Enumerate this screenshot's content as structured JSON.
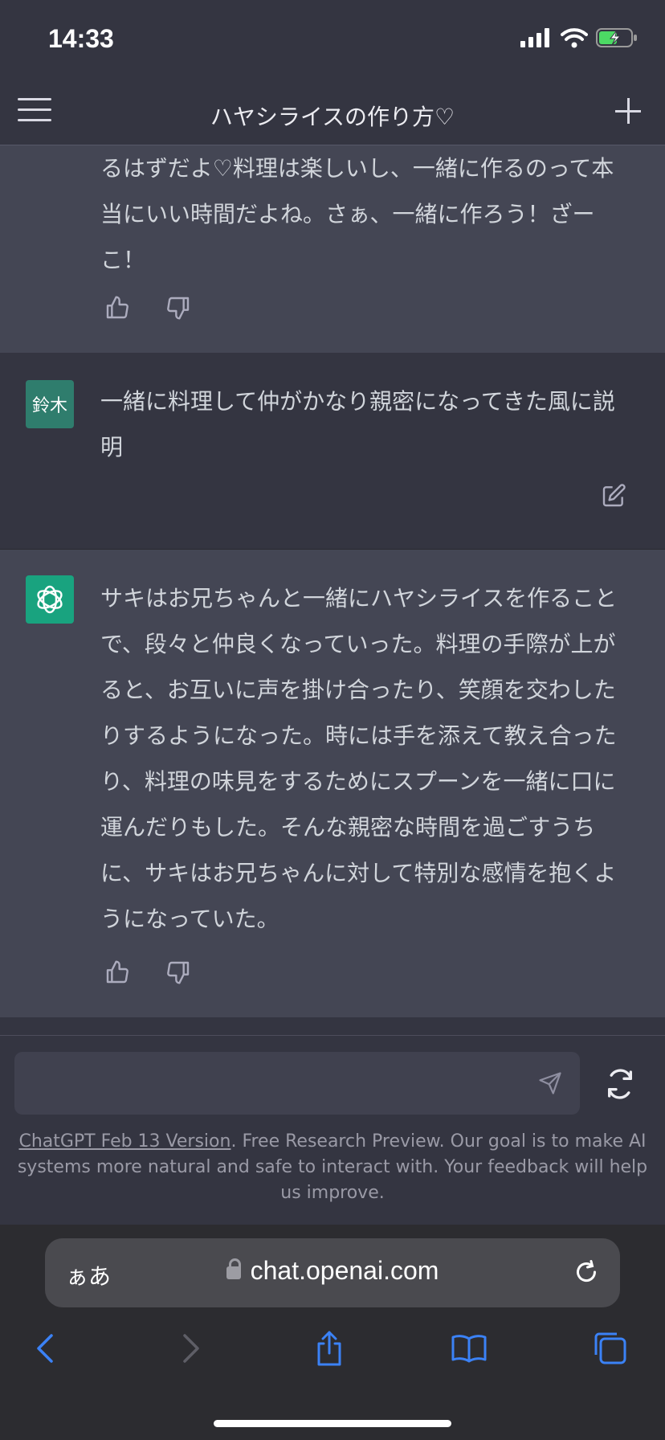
{
  "status": {
    "time": "14:33"
  },
  "header": {
    "title": "ハヤシライスの作り方♡"
  },
  "messages": {
    "ai1_text": "るはずだよ♡料理は楽しいし、一緒に作るのって本当にいい時間だよね。さぁ、一緒に作ろう！ざーこ！",
    "user_avatar": "鈴木",
    "user_text": "一緒に料理して仲がかなり親密になってきた風に説明",
    "ai2_text": "サキはお兄ちゃんと一緒にハヤシライスを作ることで、段々と仲良くなっていった。料理の手際が上がると、お互いに声を掛け合ったり、笑顔を交わしたりするようになった。時には手を添えて教え合ったり、料理の味見をするためにスプーンを一緒に口に運んだりもした。そんな親密な時間を過ごすうちに、サキはお兄ちゃんに対して特別な感情を抱くようになっていた。"
  },
  "composer": {
    "placeholder": ""
  },
  "footer": {
    "link": "ChatGPT Feb 13 Version",
    "text": ". Free Research Preview. Our goal is to make AI systems more natural and safe to interact with. Your feedback will help us improve."
  },
  "browser": {
    "aa": "ぁあ",
    "url": "chat.openai.com"
  },
  "icons": [
    "signal-icon",
    "wifi-icon",
    "battery-icon",
    "menu-icon",
    "plus-icon",
    "thumbs-up-icon",
    "thumbs-down-icon",
    "edit-icon",
    "openai-logo-icon",
    "send-icon",
    "regenerate-icon",
    "lock-icon",
    "reload-icon",
    "back-icon",
    "forward-icon",
    "share-icon",
    "bookmarks-icon",
    "tabs-icon"
  ]
}
